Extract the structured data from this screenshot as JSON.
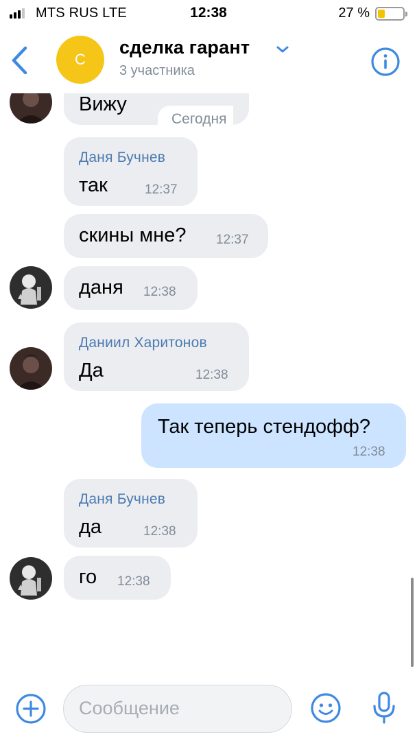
{
  "status_bar": {
    "carrier": "MTS RUS  LTE",
    "time": "12:38",
    "battery_percent": "27 %",
    "battery_level": 0.27,
    "signal_bars_active": 3
  },
  "header": {
    "avatar_letter": "С",
    "title": "сделка гарант",
    "subtitle": "3 участника",
    "avatar_color": "#f5c518",
    "accent_color": "#3f8ae0",
    "icons": [
      "chevron-left-icon",
      "chevron-down-icon",
      "info-icon"
    ]
  },
  "messages": {
    "date_separator": "Сегодня",
    "items": [
      {
        "text": "Вижу"
      },
      {
        "sender": "Даня Бучнев",
        "text": "так",
        "time": "12:37"
      },
      {
        "text": "скины мне?",
        "time": "12:37"
      },
      {
        "text": "даня",
        "time": "12:38"
      },
      {
        "sender": "Даниил Харитонов",
        "text": "Да",
        "time": "12:38"
      },
      {
        "text": "Так теперь стендофф?",
        "time": "12:38",
        "outgoing": true
      },
      {
        "sender": "Даня Бучнев",
        "text": "да",
        "time": "12:38"
      },
      {
        "text": "го",
        "time": "12:38"
      }
    ],
    "incoming_bubble_color": "#ebedf0",
    "outgoing_bubble_color": "#cce4ff"
  },
  "composer": {
    "placeholder": "Сообщение",
    "icons": [
      "add-icon",
      "emoji-icon",
      "microphone-icon"
    ]
  }
}
